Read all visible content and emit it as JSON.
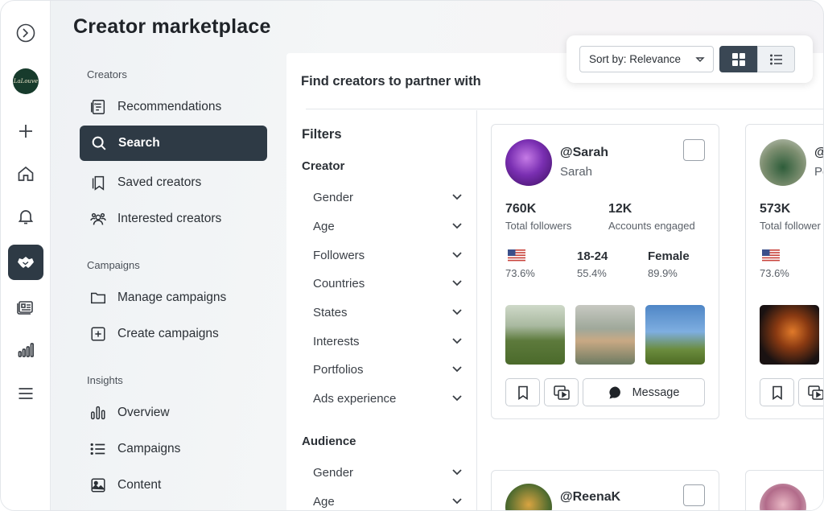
{
  "app": {
    "title": "Creator marketplace",
    "brand_avatar_text": "LaLouve",
    "colors": {
      "accent_dark": "#2e3a45",
      "border": "#dfe2e6"
    }
  },
  "rail": {
    "icons": [
      "logo-icon",
      "brand-avatar",
      "plus-icon",
      "home-icon",
      "bell-icon",
      "handshake-icon",
      "id-card-icon",
      "bar-chart-icon",
      "menu-icon"
    ],
    "active": "handshake-icon"
  },
  "nav": {
    "sections": [
      {
        "label": "Creators",
        "items": [
          {
            "label": "Recommendations",
            "icon": "document-list-icon"
          },
          {
            "label": "Search",
            "icon": "search-icon",
            "active": true
          },
          {
            "label": "Saved creators",
            "icon": "bookmark-icon"
          },
          {
            "label": "Interested creators",
            "icon": "people-icon"
          }
        ]
      },
      {
        "label": "Campaigns",
        "items": [
          {
            "label": "Manage campaigns",
            "icon": "folder-icon"
          },
          {
            "label": "Create campaigns",
            "icon": "plus-square-icon"
          }
        ]
      },
      {
        "label": "Insights",
        "items": [
          {
            "label": "Overview",
            "icon": "bars-icon"
          },
          {
            "label": "Campaigns",
            "icon": "list-icon"
          },
          {
            "label": "Content",
            "icon": "image-icon"
          }
        ]
      }
    ]
  },
  "main": {
    "heading": "Find creators to partner with"
  },
  "toolbar": {
    "sort_label": "Sort by: Relevance",
    "view_selected": "grid"
  },
  "filters": {
    "title": "Filters",
    "groups": [
      {
        "label": "Creator",
        "rows": [
          "Gender",
          "Age",
          "Followers",
          "Countries",
          "States",
          "Interests",
          "Portfolios",
          "Ads experience"
        ]
      },
      {
        "label": "Audience",
        "rows": [
          "Gender",
          "Age"
        ]
      }
    ]
  },
  "cards": [
    {
      "handle": "Sarah",
      "name": "Sarah",
      "followers": "760K",
      "followers_label": "Total followers",
      "engaged": "12K",
      "engaged_label": "Accounts engaged",
      "country_pct": "73.6%",
      "age_range": "18-24",
      "age_pct": "55.4%",
      "gender": "Female",
      "gender_pct": "89.9%",
      "message_label": "Message"
    },
    {
      "handle": "",
      "name": "Pe",
      "followers": "573K",
      "followers_label": "Total follower",
      "country_pct": "73.6%"
    },
    {
      "handle": "ReenaK"
    }
  ]
}
